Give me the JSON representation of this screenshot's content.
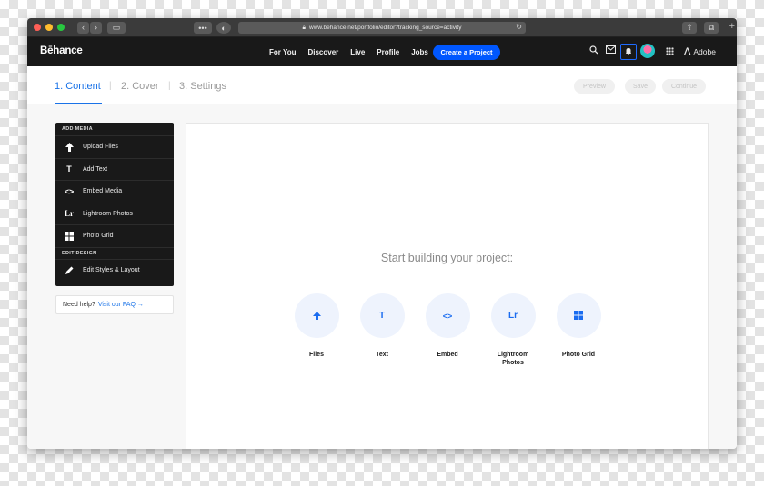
{
  "browser": {
    "url": "www.behance.net/portfolio/editor?tracking_source=activity",
    "traffic_colors": [
      "#ff5f57",
      "#febc2e",
      "#28c840"
    ]
  },
  "header": {
    "logo": "Bēhance",
    "nav": [
      "For You",
      "Discover",
      "Live",
      "Profile",
      "Jobs"
    ],
    "create_button": "Create a Project",
    "adobe": "Adobe",
    "accent": "#0057ff"
  },
  "steps": {
    "items": [
      "1. Content",
      "2. Cover",
      "3. Settings"
    ],
    "separators": [
      "|",
      "|"
    ],
    "buttons": [
      "Preview",
      "Save",
      "Continue"
    ]
  },
  "side_panel": {
    "add_media_heading": "ADD MEDIA",
    "items": [
      {
        "label": "Upload Files",
        "icon": "upload-arrow-icon"
      },
      {
        "label": "Add Text",
        "icon": "text-t-icon"
      },
      {
        "label": "Embed Media",
        "icon": "code-brackets-icon"
      },
      {
        "label": "Lightroom Photos",
        "icon": "lightroom-icon"
      },
      {
        "label": "Photo Grid",
        "icon": "grid-icon"
      }
    ],
    "edit_design_heading": "EDIT DESIGN",
    "edit_item": {
      "label": "Edit Styles & Layout",
      "icon": "pencil-icon"
    }
  },
  "help": {
    "text": "Need help?",
    "link": "Visit our FAQ →"
  },
  "canvas": {
    "title": "Start building your project:",
    "options": [
      {
        "label": "Files",
        "icon": "upload-arrow-icon"
      },
      {
        "label": "Text",
        "icon": "text-t-icon"
      },
      {
        "label": "Embed",
        "icon": "code-brackets-icon"
      },
      {
        "label": "Lightroom Photos",
        "icon": "lightroom-icon"
      },
      {
        "label": "Photo Grid",
        "icon": "grid-icon"
      }
    ]
  }
}
